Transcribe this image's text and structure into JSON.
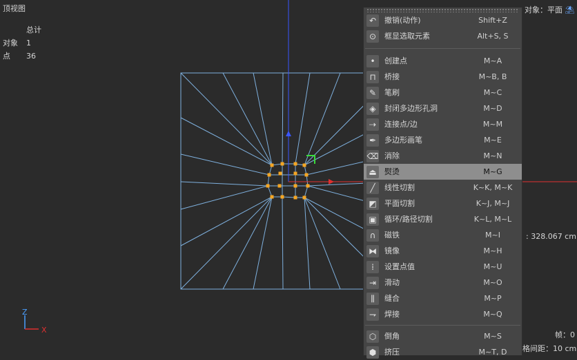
{
  "viewport": {
    "title": "顶视图",
    "stats_header": "总计",
    "stats": [
      {
        "label": "对象",
        "value": "1"
      },
      {
        "label": "点",
        "value": "36"
      }
    ],
    "axis_labels": {
      "z": "Z",
      "x": "X"
    }
  },
  "menu": {
    "group1": [
      {
        "label": "撤销(动作)",
        "shortcut": "Shift+Z",
        "icon": "undo-icon"
      },
      {
        "label": "框显选取元素",
        "shortcut": "Alt+S, S",
        "icon": "frame-selection-icon"
      }
    ],
    "group2": [
      {
        "label": "创建点",
        "shortcut": "M~A",
        "icon": "create-point-icon"
      },
      {
        "label": "桥接",
        "shortcut": "M~B, B",
        "icon": "bridge-icon"
      },
      {
        "label": "笔刷",
        "shortcut": "M~C",
        "icon": "brush-icon"
      },
      {
        "label": "封闭多边形孔洞",
        "shortcut": "M~D",
        "icon": "close-polygon-hole-icon"
      },
      {
        "label": "连接点/边",
        "shortcut": "M~M",
        "icon": "connect-points-edges-icon"
      },
      {
        "label": "多边形画笔",
        "shortcut": "M~E",
        "icon": "polygon-pen-icon"
      },
      {
        "label": "消除",
        "shortcut": "M~N",
        "icon": "dissolve-icon"
      },
      {
        "label": "熨烫",
        "shortcut": "M~G",
        "icon": "iron-icon",
        "active": true
      },
      {
        "label": "线性切割",
        "shortcut": "K~K, M~K",
        "icon": "line-cut-icon"
      },
      {
        "label": "平面切割",
        "shortcut": "K~J, M~J",
        "icon": "plane-cut-icon"
      },
      {
        "label": "循环/路径切割",
        "shortcut": "K~L, M~L",
        "icon": "loop-path-cut-icon"
      },
      {
        "label": "磁铁",
        "shortcut": "M~I",
        "icon": "magnet-icon"
      },
      {
        "label": "镜像",
        "shortcut": "M~H",
        "icon": "mirror-icon"
      },
      {
        "label": "设置点值",
        "shortcut": "M~U",
        "icon": "set-point-value-icon"
      },
      {
        "label": "滑动",
        "shortcut": "M~O",
        "icon": "slide-icon"
      },
      {
        "label": "缝合",
        "shortcut": "M~P",
        "icon": "stitch-icon"
      },
      {
        "label": "焊接",
        "shortcut": "M~Q",
        "icon": "weld-icon"
      }
    ],
    "group3": [
      {
        "label": "倒角",
        "shortcut": "M~S",
        "icon": "bevel-icon"
      },
      {
        "label": "挤压",
        "shortcut": "M~T, D",
        "icon": "extrude-icon"
      }
    ]
  },
  "right_panel": {
    "object_label": "对象：平面",
    "distance": ": 328.067 cm",
    "frame": "帧：0",
    "grid_spacing": "格间距：10 cm"
  },
  "colors": {
    "mesh": "#7fb1df",
    "point": "#f5a623",
    "axis_y": "#3a56ff",
    "axis_x": "#e03030",
    "axis_z_label": "#4aa0ff",
    "active_row": "#8e8e8e"
  }
}
